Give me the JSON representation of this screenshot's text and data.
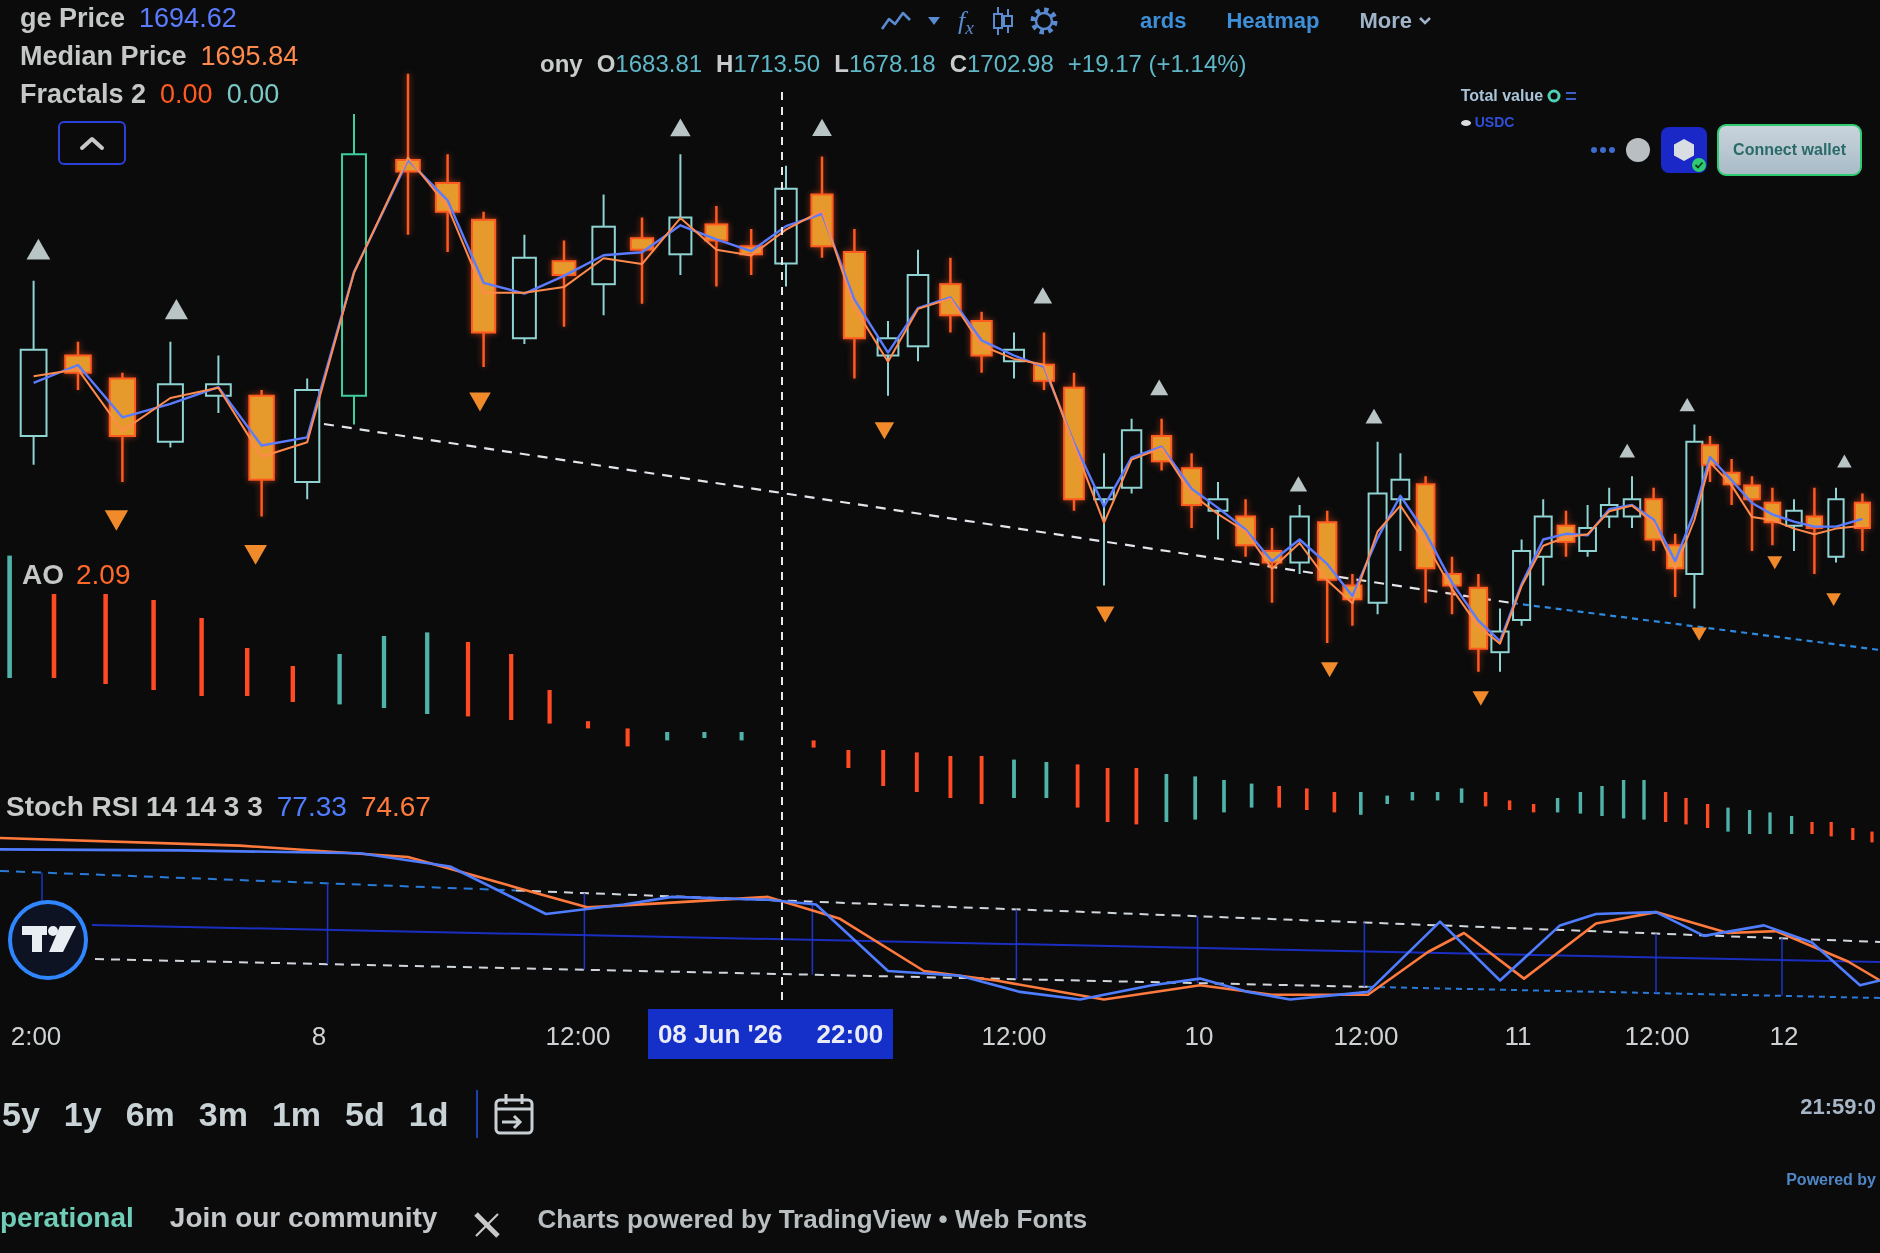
{
  "legend": {
    "indicators": [
      {
        "name": "ge Price",
        "values": [
          {
            "text": "1694.62",
            "color": "#5b7cff"
          }
        ]
      },
      {
        "name": "Median Price",
        "values": [
          {
            "text": "1695.84",
            "color": "#ff8a4c"
          }
        ]
      },
      {
        "name": "Fractals 2",
        "values": [
          {
            "text": "0.00",
            "color": "#ff5a1f"
          },
          {
            "text": "0.00",
            "color": "#7cc8c4"
          }
        ]
      }
    ]
  },
  "symbol_bar": {
    "symbol": "ony",
    "ohlc": [
      {
        "label": "O",
        "value": "1683.81"
      },
      {
        "label": "H",
        "value": "1713.50"
      },
      {
        "label": "L",
        "value": "1678.18"
      },
      {
        "label": "C",
        "value": "1702.98"
      }
    ],
    "change": "+19.17 (+1.14%)"
  },
  "toolbar": {
    "formula_button": "f$_{x}$"
  },
  "nav": [
    {
      "label": "ards",
      "kind": "link"
    },
    {
      "label": "Heatmap",
      "kind": "link"
    },
    {
      "label": "More",
      "kind": "menu"
    }
  ],
  "wallet": {
    "total_value_label": "Total value",
    "currency": "USDC",
    "connect_button": "Connect wallet"
  },
  "ao": {
    "name": "AO",
    "value": "2.09"
  },
  "stoch": {
    "name": "Stoch RSI 14 14 3 3",
    "values": [
      {
        "text": "77.33",
        "color": "#4f7dff"
      },
      {
        "text": "74.67",
        "color": "#ff7a3c"
      }
    ]
  },
  "time_axis": {
    "labels": [
      "2:00",
      "8",
      "12:00",
      "12:00",
      "10",
      "12:00",
      "11",
      "12:00",
      "12"
    ],
    "crosshair": {
      "date": "08 Jun '26",
      "time": "22:00"
    },
    "clock": "21:59:0"
  },
  "ranges": [
    {
      "label": "5y"
    },
    {
      "label": "1y"
    },
    {
      "label": "6m"
    },
    {
      "label": "3m"
    },
    {
      "label": "1m"
    },
    {
      "label": "5d"
    },
    {
      "label": "1d"
    }
  ],
  "footer": {
    "status": "perational",
    "community": "Join our community",
    "credits": "Charts powered by **TradingView** • **Web Fonts**",
    "corner": "Powered by"
  }
}
